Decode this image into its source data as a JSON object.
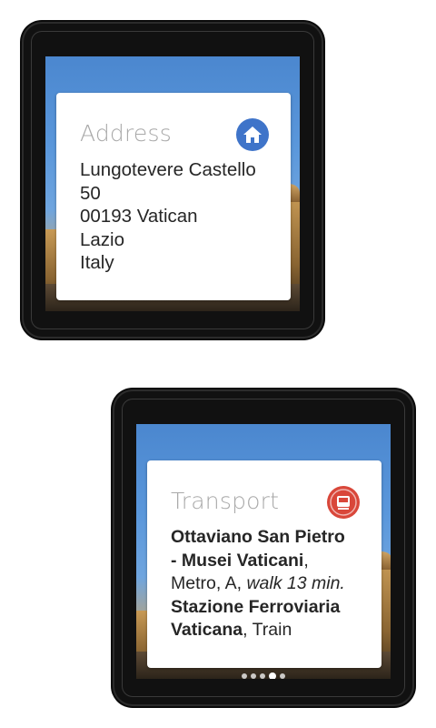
{
  "address_card": {
    "title": "Address",
    "icon": "home-icon",
    "icon_color": "#3f74c9",
    "lines": [
      "Lungotevere Castello",
      "50",
      "00193 Vatican",
      "Lazio",
      "Italy"
    ]
  },
  "transport_card": {
    "title": "Transport",
    "icon": "train-icon",
    "icon_color": "#d9473a",
    "entries": [
      {
        "name_line1": "Ottaviano San Pietro",
        "name_line2": "- Musei Vaticani",
        "after_name": ",",
        "details": "Metro, A,",
        "walk": "walk 13 min."
      },
      {
        "name_line1": "Stazione Ferroviaria",
        "name_line2": "Vaticana",
        "after_name": ", Train"
      }
    ]
  },
  "page_indicator": {
    "total": 5,
    "active_index": 3
  },
  "colors": {
    "sky": "#5a97db",
    "watch_bezel": "#111111",
    "card_title": "#a9a9a9",
    "card_text": "#262626"
  }
}
